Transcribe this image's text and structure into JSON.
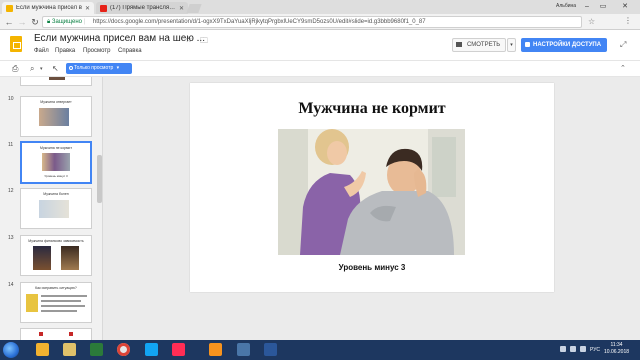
{
  "browser": {
    "tabs": [
      {
        "label": "Если мужчина присел в",
        "fav_color": "#f4b400"
      },
      {
        "label": "(17) Прямые трансляции",
        "fav_color": "#e62117"
      }
    ],
    "profile_name": "Альбина",
    "secure_label": "Защищено",
    "url": "https://docs.google.com/presentation/d/1-ogxX9TxDaYuaXljRjkytqPrgbxlUeCY9smD5ozs0U/edit#slide=id.g3bbb9680f1_0_87"
  },
  "docs": {
    "title": "Если мужчина присел вам на шею ...",
    "menu": [
      "Файл",
      "Правка",
      "Просмотр",
      "Справка"
    ],
    "present_label": "СМОТРЕТЬ",
    "share_label": "НАСТРОЙКИ ДОСТУПА",
    "view_only_label": "Только просмотр"
  },
  "filmstrip": {
    "slides": [
      {
        "number": "",
        "title": "",
        "caption": ""
      },
      {
        "number": "10",
        "title": "Мужчина отвергает",
        "caption": ""
      },
      {
        "number": "11",
        "title": "Мужчина не кормит",
        "caption": ""
      },
      {
        "number": "12",
        "title": "Мужчина болен",
        "caption": ""
      },
      {
        "number": "13",
        "title": "Мужчина финансово зависимость",
        "caption": ""
      },
      {
        "number": "14",
        "title": "Как исправить ситуацию?",
        "caption": ""
      }
    ]
  },
  "slide": {
    "title": "Мужчина не кормит",
    "caption": "Уровень минус 3"
  },
  "taskbar": {
    "language": "РУС",
    "time": "11:34",
    "date": "10.06.2018"
  }
}
